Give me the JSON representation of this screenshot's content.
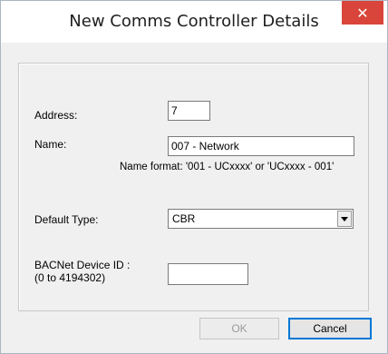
{
  "window": {
    "title": "New Comms Controller Details",
    "close_glyph": "✕"
  },
  "form": {
    "address": {
      "label": "Address:",
      "value": "7"
    },
    "name": {
      "label": "Name:",
      "value": "007 - Network",
      "hint": "Name format: '001 - UCxxxx' or 'UCxxxx - 001'"
    },
    "default_type": {
      "label": "Default Type:",
      "selected": "CBR"
    },
    "bacnet": {
      "label_line1": "BACNet Device ID :",
      "label_line2": "(0 to 4194302)",
      "value": ""
    }
  },
  "buttons": {
    "ok_label": "OK",
    "cancel_label": "Cancel"
  },
  "colors": {
    "close_button": "#d9453a",
    "focus_border": "#0078d7"
  }
}
